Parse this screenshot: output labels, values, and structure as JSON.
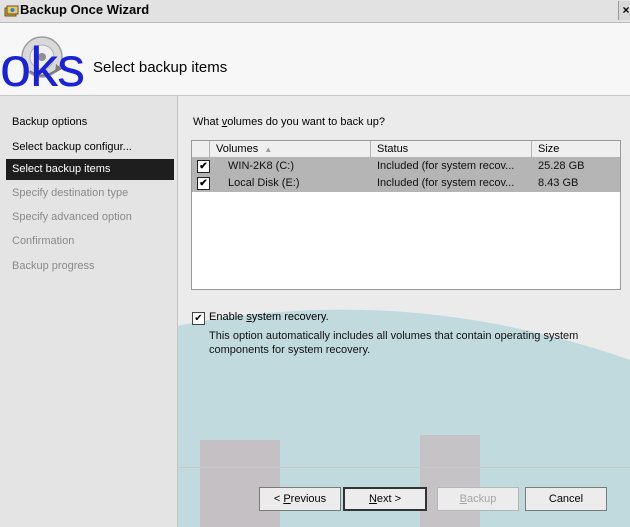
{
  "window": {
    "title": "Backup Once Wizard",
    "close_glyph": "×"
  },
  "header": {
    "title": "Select backup items",
    "watermark": "oks"
  },
  "nav": {
    "items": [
      {
        "label": "Backup options",
        "state": "done"
      },
      {
        "label": "Select backup configur...",
        "state": "done"
      },
      {
        "label": "Select backup items",
        "state": "current"
      },
      {
        "label": "Specify destination type",
        "state": "pending"
      },
      {
        "label": "Specify advanced option",
        "state": "pending"
      },
      {
        "label": "Confirmation",
        "state": "pending"
      },
      {
        "label": "Backup progress",
        "state": "pending"
      }
    ]
  },
  "main": {
    "question_pre": "What ",
    "question_key": "v",
    "question_post": "olumes do you want to back up?",
    "columns": {
      "volumes": "Volumes",
      "status": "Status",
      "size": "Size"
    },
    "rows": [
      {
        "checked": true,
        "volume": "WIN-2K8 (C:)",
        "status": "Included (for system recov...",
        "size": "25.28 GB"
      },
      {
        "checked": true,
        "volume": "Local Disk (E:)",
        "status": "Included (for system recov...",
        "size": "8.43 GB"
      }
    ],
    "system_recovery": {
      "checked": true,
      "label_pre": "Enable ",
      "label_key": "s",
      "label_post": "ystem recovery.",
      "description": "This option automatically includes all volumes that contain operating system components for system recovery."
    }
  },
  "buttons": {
    "previous": {
      "pre": "< ",
      "key": "P",
      "post": "revious"
    },
    "next": {
      "pre": "",
      "key": "N",
      "post": "ext >"
    },
    "backup": {
      "pre": "",
      "key": "B",
      "post": "ackup"
    },
    "cancel": {
      "label": "Cancel"
    }
  },
  "colors": {
    "nav_current_bg": "#1e1e1e",
    "row_highlight": "#b5b5b5",
    "watermark": "#1a22d6",
    "background_teal": "#2f9fb0",
    "background_red": "#d94b4b"
  },
  "icons": {
    "title": "backup-wizard-icon",
    "header": "backup-disc-icon",
    "check": "✔",
    "sort": "▲"
  }
}
